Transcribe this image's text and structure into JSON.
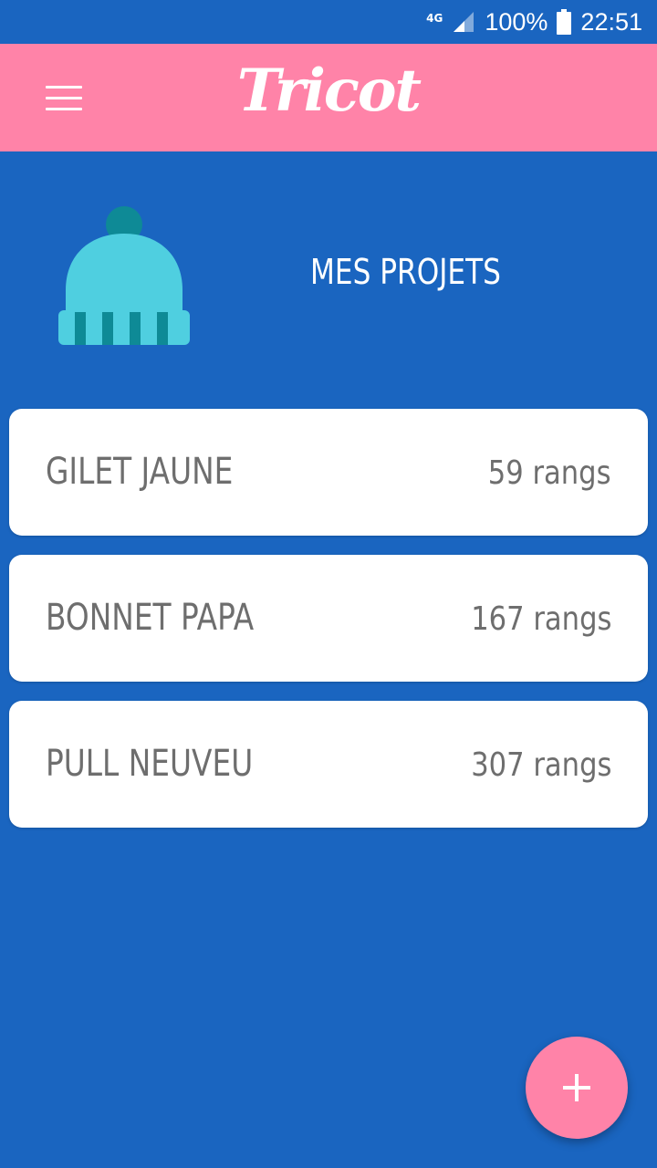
{
  "status_bar": {
    "network": "4G",
    "battery_percent": "100%",
    "time": "22:51"
  },
  "app_bar": {
    "title": "Tricot",
    "menu_icon": "hamburger-menu-icon"
  },
  "header": {
    "title": "MES PROJETS",
    "illustration": "beanie-hat-icon"
  },
  "projects": [
    {
      "name": "GILET JAUNE",
      "rows": "59 rangs"
    },
    {
      "name": "BONNET PAPA",
      "rows": "167 rangs"
    },
    {
      "name": "PULL NEUVEU",
      "rows": "307 rangs"
    }
  ],
  "fab": {
    "icon": "plus-icon"
  },
  "colors": {
    "background": "#1A65C0",
    "accent": "#FF83A8",
    "card": "#FFFFFF",
    "card_text": "#6E6E6E",
    "hat_light": "#4FCFE0",
    "hat_dark": "#0E8A96"
  }
}
